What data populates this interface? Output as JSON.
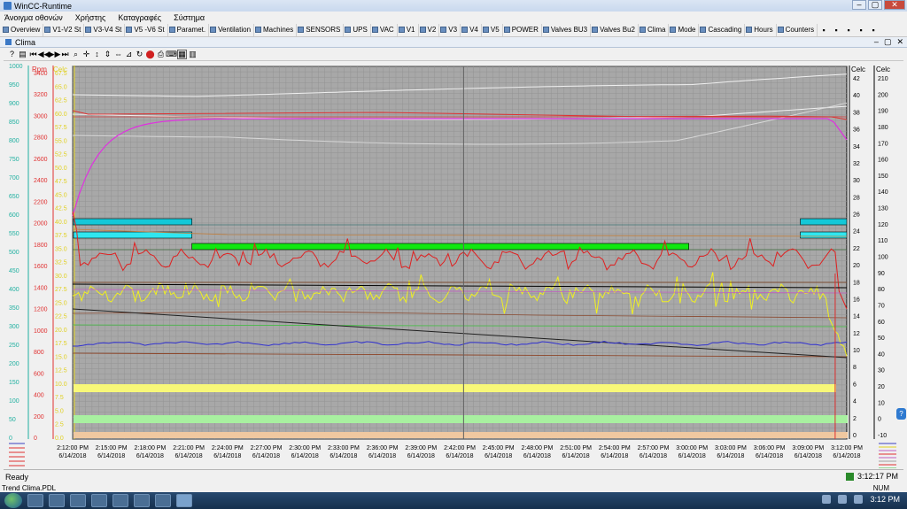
{
  "window": {
    "title": "WinCC-Runtime"
  },
  "menu": [
    "Άνοιγμα οθονών",
    "Χρήστης",
    "Καταγραφές",
    "Σύστημα"
  ],
  "nav": [
    "Overview",
    "V1-V2 St",
    "V3-V4 St",
    "V5 -V6 St",
    "Paramet.",
    "Ventilation",
    "Machines",
    "SENSORS",
    "UPS",
    "VAC",
    "V1",
    "V2",
    "V3",
    "V4",
    "V5",
    "POWER",
    "Valves BU3",
    "Valves Bu2",
    "Clima",
    "Mode",
    "Cascading",
    "Hours",
    "Counters"
  ],
  "document": {
    "title": "Clima"
  },
  "trend": {
    "left_axes": [
      {
        "name": "",
        "color": "#20b0a0",
        "ticks": [
          "1000",
          "950",
          "900",
          "850",
          "800",
          "750",
          "700",
          "650",
          "600",
          "550",
          "500",
          "450",
          "400",
          "350",
          "300",
          "250",
          "200",
          "150",
          "100",
          "50",
          "0"
        ]
      },
      {
        "name": "Rpm",
        "color": "#e03030",
        "ticks": [
          "3400",
          "3200",
          "3000",
          "2800",
          "2600",
          "2400",
          "2200",
          "2000",
          "1800",
          "1600",
          "1400",
          "1200",
          "1000",
          "800",
          "600",
          "400",
          "200",
          "0"
        ]
      },
      {
        "name": "Celc",
        "color": "#e0d020",
        "ticks": [
          "67.5",
          "65.0",
          "62.5",
          "60.0",
          "57.5",
          "55.0",
          "52.5",
          "50.0",
          "47.5",
          "45.0",
          "42.5",
          "40.0",
          "37.5",
          "35.0",
          "32.5",
          "30.0",
          "27.5",
          "25.0",
          "22.5",
          "20.0",
          "17.5",
          "15.0",
          "12.5",
          "10.0",
          "7.5",
          "5.0",
          "2.5",
          "0.0"
        ]
      }
    ],
    "right_axes": [
      {
        "name": "Celc",
        "ticks": [
          "42",
          "40",
          "38",
          "36",
          "34",
          "32",
          "30",
          "28",
          "26",
          "24",
          "22",
          "20",
          "18",
          "16",
          "14",
          "12",
          "10",
          "8",
          "6",
          "4",
          "2",
          "0"
        ]
      },
      {
        "name": "Celc",
        "ticks": [
          "210",
          "200",
          "190",
          "180",
          "170",
          "160",
          "150",
          "140",
          "130",
          "120",
          "110",
          "100",
          "90",
          "80",
          "70",
          "60",
          "50",
          "40",
          "30",
          "20",
          "10",
          "0",
          "-10"
        ]
      }
    ],
    "time_labels": [
      "2:12:00 PM",
      "2:15:00 PM",
      "2:18:00 PM",
      "2:21:00 PM",
      "2:24:00 PM",
      "2:27:00 PM",
      "2:30:00 PM",
      "2:33:00 PM",
      "2:36:00 PM",
      "2:39:00 PM",
      "2:42:00 PM",
      "2:45:00 PM",
      "2:48:00 PM",
      "2:51:00 PM",
      "2:54:00 PM",
      "2:57:00 PM",
      "3:00:00 PM",
      "3:03:00 PM",
      "3:06:00 PM",
      "3:09:00 PM",
      "3:12:00 PM"
    ],
    "date_label": "6/14/2018"
  },
  "status": {
    "text": "Ready",
    "time": "3:12:17 PM",
    "file": "Trend Clima.PDL",
    "mode": "NUM"
  },
  "taskbar": {
    "clock": "3:12 PM"
  }
}
